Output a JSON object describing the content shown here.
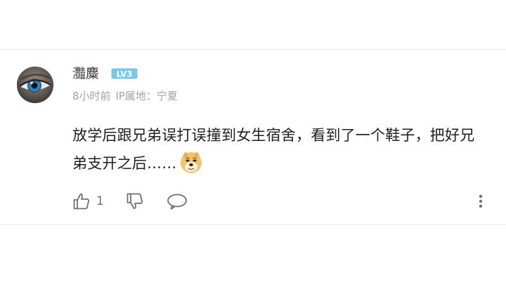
{
  "comment": {
    "username": "灩麋",
    "level": "LV3",
    "time": "8小时前",
    "ip_label": "IP属地：宁夏",
    "text": "放学后跟兄弟误打误撞到女生宿舍，看到了一个鞋子，把好兄弟支开之后……",
    "emoji": "doge-emoji-icon",
    "like_count": "1"
  },
  "colors": {
    "username": "#3c3c3c",
    "meta": "#a3a3a3",
    "text": "#1f1f1f",
    "icon": "#707070",
    "level_badge": "#7cc7e8"
  }
}
